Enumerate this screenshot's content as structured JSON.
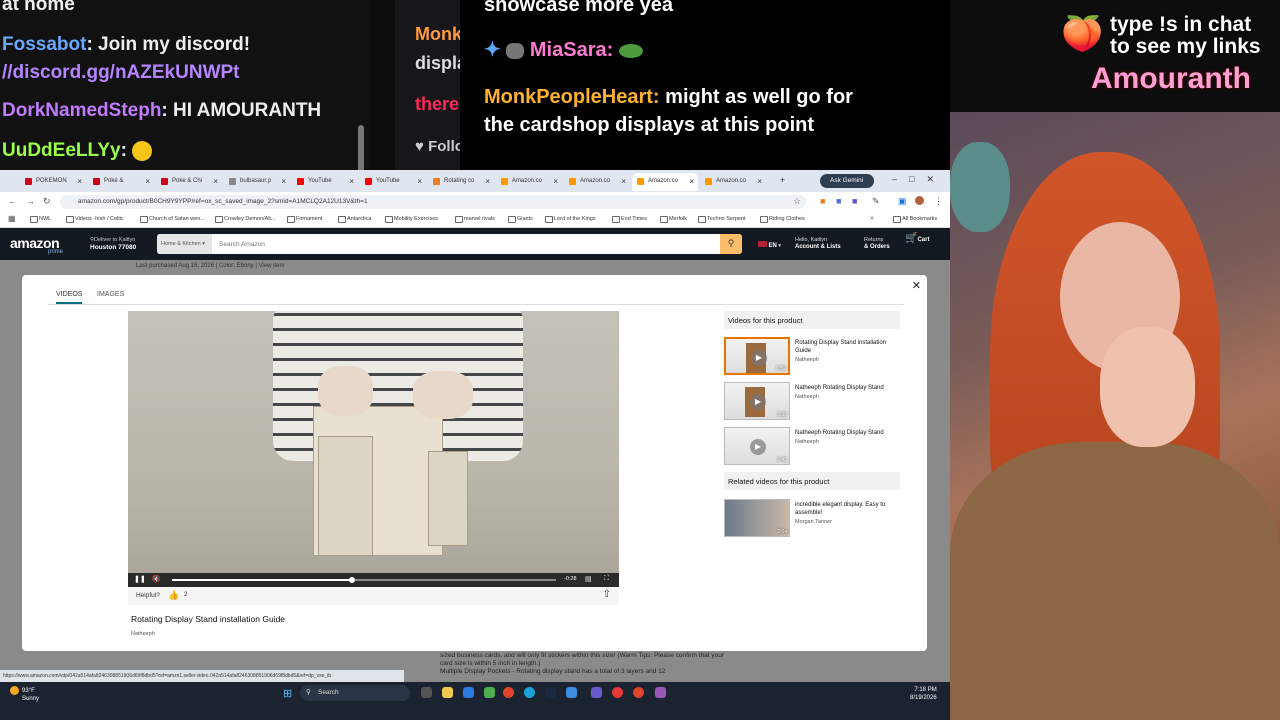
{
  "stream": {
    "chat_left": [
      {
        "text": "at home",
        "color": "#ffffff"
      },
      {
        "user": "Fossabot",
        "msg": ": Join my discord!",
        "color": "#6aa8ff"
      },
      {
        "text": "//discord.gg/nAZEkUNWPt",
        "color": "#b584ff"
      },
      {
        "user": "DorkNamedSteph",
        "msg": ": HI AMOURANTH",
        "color": "#c07cff"
      },
      {
        "user": "UuDdEeLLYy",
        "msg": ":",
        "color": "#9aff48"
      }
    ],
    "chat_middle": [
      "Monk",
      "displa",
      "there",
      "Follo"
    ],
    "chat_right": {
      "line1": "showcase more yea",
      "user1": "MiaSara:",
      "user2": "MonkPeopleHeart:",
      "msg2a": "might as well go for",
      "msg2b": "the cardshop displays at this point"
    },
    "branding": {
      "line1": "type !s in chat",
      "line2": "to see my links",
      "name": "Amouranth"
    }
  },
  "browser": {
    "tabs": [
      {
        "label": "POKEMON",
        "color": "#d0021b"
      },
      {
        "label": "Poké & ",
        "color": "#d0021b"
      },
      {
        "label": "Poke & Chi",
        "color": "#d0021b"
      },
      {
        "label": "bulbasaur.p",
        "color": "#888888"
      },
      {
        "label": "YouTube",
        "color": "#ff0000"
      },
      {
        "label": "YouTube",
        "color": "#ff0000"
      },
      {
        "label": "Rotating co",
        "color": "#e67e22"
      },
      {
        "label": "Amazon.co",
        "color": "#ff9900"
      },
      {
        "label": "Amazon.co",
        "color": "#ff9900"
      },
      {
        "label": "Amazon.co",
        "color": "#ff9900"
      },
      {
        "label": "Amazon.co",
        "color": "#ff9900"
      }
    ],
    "active_tab_index": 9,
    "gemini_label": "Ask Gemini",
    "url": "amazon.com/gp/product/B0CH9Y9YPP/ref=ox_sc_saved_image_2?smid=A1MCLQ2A12U13V&th=1",
    "bookmarks": [
      "NWL",
      "Videos -Irish / Celtic",
      "Church of Satan wen...",
      "Crowley Demon/Ali...",
      "Firmament",
      "Antarctica",
      "Mobility Exercises",
      "marvel rivals",
      "Giants",
      "Lord of the Kings",
      "End Times",
      "Merfolk",
      "Techno Serpent",
      "Riding Clothes"
    ],
    "all_bookmarks": "All Bookmarks",
    "amazon": {
      "logo": "amazon",
      "prime": "prime",
      "deliver_line1": "Deliver to Kaitlyn",
      "deliver_line2": "Houston 77080",
      "search_category": "Home & Kitchen",
      "search_placeholder": "Search Amazon",
      "lang": "EN",
      "account_line1": "Hello, Kaitlyn",
      "account_line2": "Account & Lists",
      "returns_line1": "Returns",
      "returns_line2": "& Orders",
      "cart": "Cart",
      "cart_count": "0",
      "last_purchased": "Last purchased Aug 16, 2026",
      "color_info": "Color: Ebony",
      "view_item": "View item",
      "bottom_text": "sized business cards, and will only fit stickers within this size! (Warm Tips: Please confirm that your card size is within 5 inch in length.)",
      "bottom_text2": "Multiple Display Pockets - Rotating display stand has a total of 3 layers and 12"
    },
    "modal": {
      "tab_videos": "VIDEOS",
      "tab_images": "IMAGES",
      "video_time": "-0:28",
      "video_progress": 0.47,
      "helpful_label": "Helpful?",
      "helpful_count": "2",
      "video_title": "Rotating Display Stand installation Guide",
      "video_author": "Natheeph",
      "videos_header": "Videos for this product",
      "videos": [
        {
          "title": "Rotating Display Stand installation Guide",
          "by": "Natheeph",
          "duration": "0:52",
          "selected": true
        },
        {
          "title": "Natheeph Rotating Display Stand",
          "by": "Natheeph",
          "duration": "0:36",
          "selected": false
        },
        {
          "title": "Natheeph Rotating Display Stand",
          "by": "Natheeph",
          "duration": "0:45",
          "selected": false
        }
      ],
      "related_header": "Related videos for this product",
      "related": [
        {
          "title": "incredible elegant display. Easy to assemble!",
          "by": "Morgan Tanner",
          "duration": "2:04"
        }
      ]
    },
    "status_url": "https://www.amazon.com/vdp/042a514afa8246308851906d69f8dbd5?ref=amzn1.seller.video.042a514afa8246308851906d69f8dbd5&ref=dp_vse_ib"
  },
  "taskbar": {
    "temp": "93°F",
    "weather": "Sunny",
    "search_placeholder": "Search",
    "time": "7:18 PM",
    "date": "8/19/2026"
  }
}
